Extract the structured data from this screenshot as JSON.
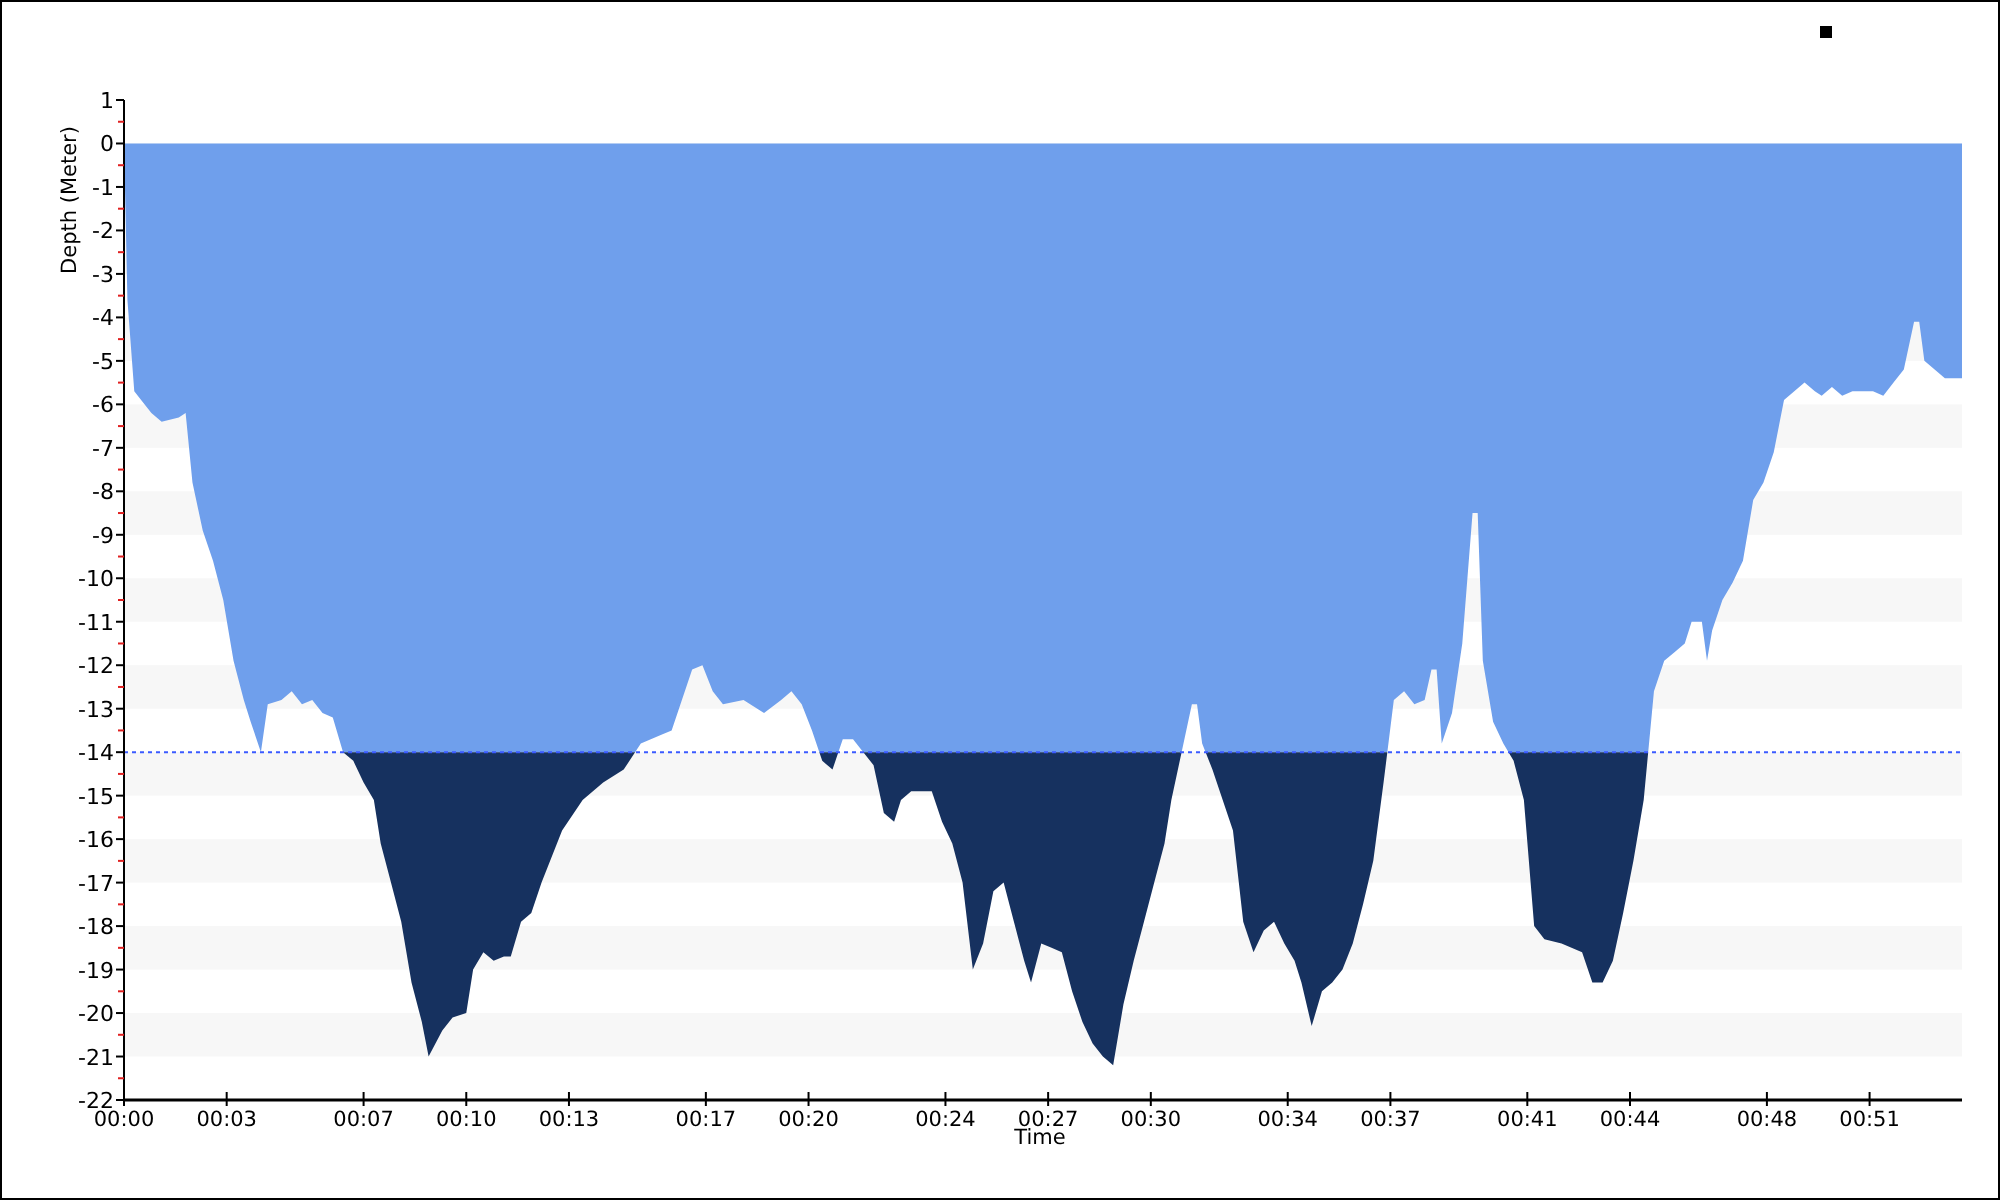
{
  "chart_data": {
    "type": "area",
    "xlabel": "Time",
    "ylabel": "Depth (Meter)",
    "xlim": [
      0,
      53.7
    ],
    "ylim": [
      -22,
      1
    ],
    "xticks": [
      {
        "value": 0,
        "label": "00:00"
      },
      {
        "value": 3,
        "label": "00:03"
      },
      {
        "value": 7,
        "label": "00:07"
      },
      {
        "value": 10,
        "label": "00:10"
      },
      {
        "value": 13,
        "label": "00:13"
      },
      {
        "value": 17,
        "label": "00:17"
      },
      {
        "value": 20,
        "label": "00:20"
      },
      {
        "value": 24,
        "label": "00:24"
      },
      {
        "value": 27,
        "label": "00:27"
      },
      {
        "value": 30,
        "label": "00:30"
      },
      {
        "value": 34,
        "label": "00:34"
      },
      {
        "value": 37,
        "label": "00:37"
      },
      {
        "value": 41,
        "label": "00:41"
      },
      {
        "value": 44,
        "label": "00:44"
      },
      {
        "value": 48,
        "label": "00:48"
      },
      {
        "value": 51,
        "label": "00:51"
      }
    ],
    "yticks": [
      1,
      0,
      -1,
      -2,
      -3,
      -4,
      -5,
      -6,
      -7,
      -8,
      -9,
      -10,
      -11,
      -12,
      -13,
      -14,
      -15,
      -16,
      -17,
      -18,
      -19,
      -20,
      -21,
      -22
    ],
    "x": [
      0,
      0.1,
      0.3,
      0.5,
      0.8,
      1.1,
      1.6,
      1.8,
      2.0,
      2.3,
      2.6,
      2.9,
      3.2,
      3.5,
      3.7,
      4.0,
      4.2,
      4.6,
      4.9,
      5.2,
      5.5,
      5.8,
      6.1,
      6.4,
      6.7,
      7.0,
      7.3,
      7.5,
      7.8,
      8.1,
      8.4,
      8.7,
      8.9,
      9.3,
      9.6,
      10.0,
      10.2,
      10.5,
      10.8,
      11.1,
      11.3,
      11.6,
      11.9,
      12.2,
      12.8,
      13.4,
      14.0,
      14.6,
      15.1,
      15.7,
      16.0,
      16.6,
      16.9,
      17.2,
      17.5,
      18.1,
      18.7,
      19.2,
      19.5,
      19.8,
      20.1,
      20.4,
      20.7,
      21.0,
      21.3,
      21.6,
      21.9,
      22.2,
      22.5,
      22.7,
      23.0,
      23.3,
      23.6,
      23.9,
      24.2,
      24.5,
      24.8,
      25.1,
      25.4,
      25.7,
      26.0,
      26.3,
      26.5,
      26.8,
      27.1,
      27.4,
      27.7,
      28.0,
      28.3,
      28.6,
      28.9,
      29.2,
      29.5,
      29.8,
      30.1,
      30.4,
      30.6,
      30.9,
      31.2,
      31.35,
      31.5,
      31.8,
      32.1,
      32.4,
      32.7,
      33.0,
      33.3,
      33.6,
      33.9,
      34.2,
      34.4,
      34.7,
      35.0,
      35.3,
      35.6,
      35.9,
      36.2,
      36.5,
      36.8,
      37.1,
      37.4,
      37.7,
      38.0,
      38.2,
      38.35,
      38.5,
      38.8,
      39.1,
      39.4,
      39.55,
      39.7,
      40.0,
      40.3,
      40.6,
      40.9,
      41.2,
      41.5,
      42.0,
      42.6,
      42.9,
      43.2,
      43.5,
      43.8,
      44.1,
      44.4,
      44.7,
      45.0,
      45.3,
      45.6,
      45.8,
      46.1,
      46.25,
      46.4,
      46.7,
      47.0,
      47.3,
      47.6,
      47.9,
      48.2,
      48.5,
      48.8,
      49.1,
      49.4,
      49.6,
      49.9,
      50.2,
      50.5,
      50.8,
      51.1,
      51.4,
      51.7,
      52.0,
      52.3,
      52.45,
      52.6,
      52.9,
      53.2,
      53.7
    ],
    "series": [
      {
        "color": "#6f9fec",
        "values": [
          0,
          -3.6,
          -5.7,
          -5.9,
          -6.2,
          -6.4,
          -6.3,
          -6.2,
          -7.8,
          -8.9,
          -9.6,
          -10.5,
          -11.9,
          -12.8,
          -13.3,
          -14.0,
          -12.9,
          -12.8,
          -12.6,
          -12.9,
          -12.8,
          -13.1,
          -13.2,
          -14.0,
          -14.2,
          -14.7,
          -15.1,
          -16.1,
          -17.0,
          -17.9,
          -19.3,
          -20.2,
          -21.0,
          -20.4,
          -20.1,
          -20.0,
          -19.0,
          -18.6,
          -18.8,
          -18.7,
          -18.7,
          -17.9,
          -17.7,
          -17.0,
          -15.8,
          -15.1,
          -14.7,
          -14.4,
          -13.8,
          -13.6,
          -13.5,
          -12.1,
          -12.0,
          -12.6,
          -12.9,
          -12.8,
          -13.1,
          -12.8,
          -12.6,
          -12.9,
          -13.5,
          -14.2,
          -14.4,
          -13.7,
          -13.7,
          -14.0,
          -14.3,
          -15.4,
          -15.6,
          -15.1,
          -14.9,
          -14.9,
          -14.9,
          -15.6,
          -16.1,
          -17.0,
          -19.0,
          -18.4,
          -17.2,
          -17.0,
          -17.9,
          -18.8,
          -19.3,
          -18.4,
          -18.5,
          -18.6,
          -19.5,
          -20.2,
          -20.7,
          -21.0,
          -21.2,
          -19.8,
          -18.8,
          -17.9,
          -17.0,
          -16.1,
          -15.1,
          -14.0,
          -12.9,
          -12.9,
          -13.8,
          -14.4,
          -15.1,
          -15.8,
          -17.9,
          -18.6,
          -18.1,
          -17.9,
          -18.4,
          -18.8,
          -19.3,
          -20.3,
          -19.5,
          -19.3,
          -19.0,
          -18.4,
          -17.5,
          -16.5,
          -14.7,
          -12.8,
          -12.6,
          -12.9,
          -12.8,
          -12.1,
          -12.1,
          -13.8,
          -13.1,
          -11.5,
          -8.5,
          -8.5,
          -11.9,
          -13.3,
          -13.8,
          -14.2,
          -15.1,
          -18.0,
          -18.3,
          -18.4,
          -18.6,
          -19.3,
          -19.3,
          -18.8,
          -17.7,
          -16.5,
          -15.1,
          -12.6,
          -11.9,
          -11.7,
          -11.5,
          -11.0,
          -11.0,
          -11.9,
          -11.2,
          -10.5,
          -10.1,
          -9.6,
          -8.2,
          -7.8,
          -7.1,
          -5.9,
          -5.7,
          -5.5,
          -5.7,
          -5.8,
          -5.6,
          -5.8,
          -5.7,
          -5.7,
          -5.7,
          -5.8,
          -5.5,
          -5.2,
          -4.1,
          -4.1,
          -5.0,
          -5.2,
          -5.4,
          -5.4
        ]
      }
    ],
    "ref_lines": [
      {
        "axis": "y",
        "value": -14
      }
    ]
  }
}
